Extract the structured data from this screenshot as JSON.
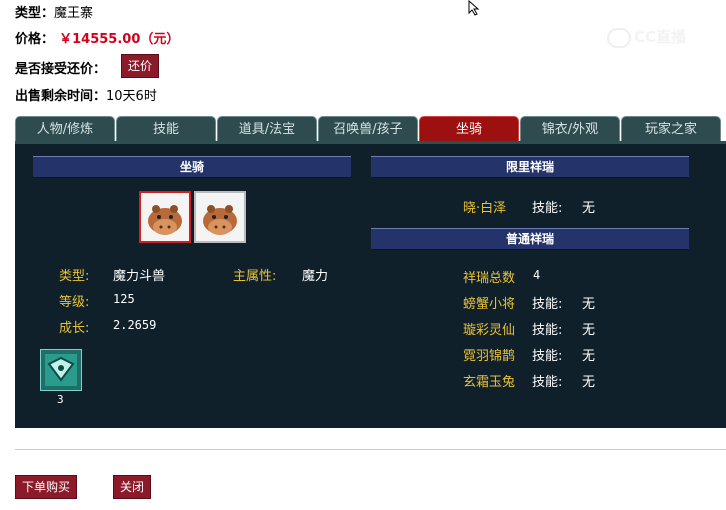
{
  "info": {
    "type_label": "类型：",
    "type_value": "魔王寨",
    "price_label": "价格：",
    "price_value": "￥14555.00（元）",
    "bargain_label": "是否接受还价：",
    "bargain_button": "还价",
    "time_label": "出售剩余时间：",
    "time_value": "10天6时"
  },
  "watermark": "CC直播",
  "tabs": [
    {
      "label": "人物/修炼",
      "active": false
    },
    {
      "label": "技能",
      "active": false
    },
    {
      "label": "道具/法宝",
      "active": false
    },
    {
      "label": "召唤兽/孩子",
      "active": false
    },
    {
      "label": "坐骑",
      "active": true
    },
    {
      "label": "锦衣/外观",
      "active": false
    },
    {
      "label": "玩家之家",
      "active": false
    }
  ],
  "mount": {
    "header": "坐骑",
    "type_label": "类型:",
    "type_value": "魔力斗兽",
    "main_attr_label": "主属性:",
    "main_attr_value": "魔力",
    "level_label": "等级:",
    "level_value": "125",
    "growth_label": "成长:",
    "growth_value": "2.2659",
    "item_count": "3"
  },
  "limited": {
    "header": "限里祥瑞",
    "name": "晓·白泽",
    "skill_label": "技能:",
    "skill_value": "无"
  },
  "normal": {
    "header": "普通祥瑞",
    "total_label": "祥瑞总数",
    "total_value": "4",
    "items": [
      {
        "name": "螃蟹小将",
        "skill_label": "技能:",
        "skill_value": "无"
      },
      {
        "name": "璇彩灵仙",
        "skill_label": "技能:",
        "skill_value": "无"
      },
      {
        "name": "霓羽锦鹊",
        "skill_label": "技能:",
        "skill_value": "无"
      },
      {
        "name": "玄霜玉兔",
        "skill_label": "技能:",
        "skill_value": "无"
      }
    ]
  },
  "actions": {
    "buy": "下单购买",
    "close": "关闭"
  },
  "colors": {
    "accent_red": "#8b1a2b",
    "panel_bg": "#10202a",
    "label_gold": "#e8c236",
    "header_blue": "#24346a"
  }
}
